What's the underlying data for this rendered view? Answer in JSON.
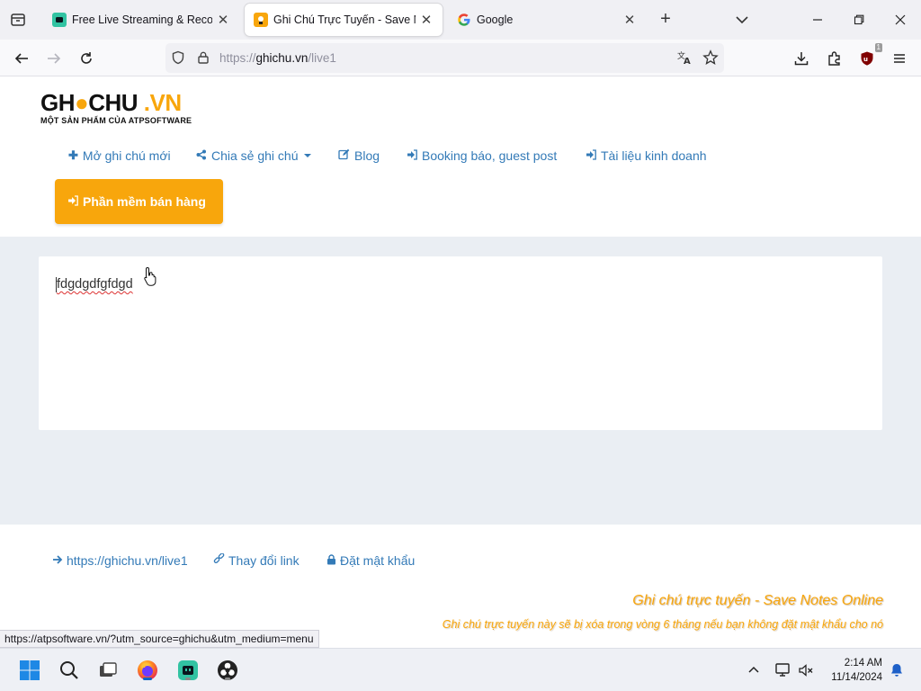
{
  "browser": {
    "tabs": [
      {
        "title": "Free Live Streaming & Recording",
        "active": false,
        "favicon": "streamlabs-icon"
      },
      {
        "title": "Ghi Chú Trực Tuyến - Save Notes",
        "active": true,
        "favicon": "ghichu-icon"
      },
      {
        "title": "Google",
        "active": false,
        "favicon": "google-icon"
      }
    ],
    "new_tab": "+",
    "url": {
      "scheme": "https://",
      "host": "ghichu.vn",
      "path": "/live1"
    },
    "extension_badge": "1"
  },
  "site": {
    "logo": {
      "part1": "GH",
      "part2": "CHU",
      "part3": ".VN",
      "tagline": "MỘT SẢN PHẨM CỦA ATPSOFTWARE"
    },
    "menu": [
      {
        "icon": "plus-icon",
        "label": "Mở ghi chú mới"
      },
      {
        "icon": "share-icon",
        "label": "Chia sẻ ghi chú"
      },
      {
        "icon": "edit-icon",
        "label": "Blog"
      },
      {
        "icon": "sign-in-icon",
        "label": "Booking báo, guest post"
      },
      {
        "icon": "sign-in-icon",
        "label": "Tài liệu kinh doanh"
      }
    ],
    "cta_label": "Phần mềm bán hàng",
    "note_text": "fdgdgdfgfdgd",
    "footer": {
      "link_url": "https://ghichu.vn/live1",
      "change_link": "Thay đổi link",
      "set_password": "Đặt mật khẩu",
      "tagline": "Ghi chú trực tuyến - Save Notes Online",
      "subline": "Ghi chú trực tuyến này sẽ bị xóa trong vòng 6 tháng nếu bạn không đặt mật khẩu cho nó"
    },
    "status_url": "https://atpsoftware.vn/?utm_source=ghichu&utm_medium=menu"
  },
  "colors": {
    "accent": "#f8a60c",
    "link": "#337ab7",
    "band": "#eaeef3"
  },
  "taskbar": {
    "apps": [
      "windows-start-icon",
      "search-icon",
      "task-view-icon",
      "firefox-icon",
      "streamlabs-icon",
      "obs-icon"
    ],
    "time": "2:14 AM",
    "date": "11/14/2024"
  }
}
